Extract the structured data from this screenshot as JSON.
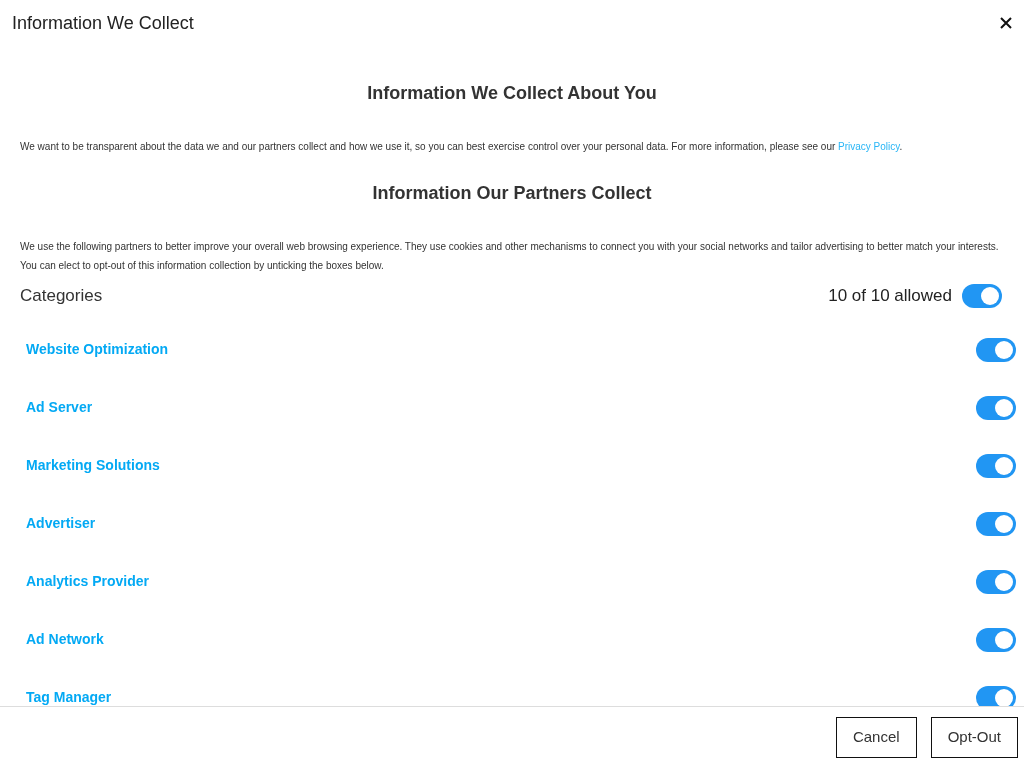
{
  "dialog": {
    "title": "Information We Collect"
  },
  "sections": [
    {
      "heading": "Information We Collect About You",
      "text": "We want to be transparent about the data we and our partners collect and how we use it, so you can best exercise control over your personal data. For more information, please see our ",
      "link": "Privacy Policy",
      "after": "."
    },
    {
      "heading": "Information Our Partners Collect",
      "text": "We use the following partners to better improve your overall web browsing experience. They use cookies and other mechanisms to connect you with your social networks and tailor advertising to better match your interests. You can elect to opt-out of this information collection by unticking the boxes below."
    }
  ],
  "categories": {
    "label": "Categories",
    "count": "10 of 10 allowed",
    "all_on": true,
    "items": [
      {
        "name": "Website Optimization",
        "on": true
      },
      {
        "name": "Ad Server",
        "on": true
      },
      {
        "name": "Marketing Solutions",
        "on": true
      },
      {
        "name": "Advertiser",
        "on": true
      },
      {
        "name": "Analytics Provider",
        "on": true
      },
      {
        "name": "Ad Network",
        "on": true
      },
      {
        "name": "Tag Manager",
        "on": true
      }
    ]
  },
  "buttons": [
    "Cancel",
    "Opt-Out"
  ]
}
